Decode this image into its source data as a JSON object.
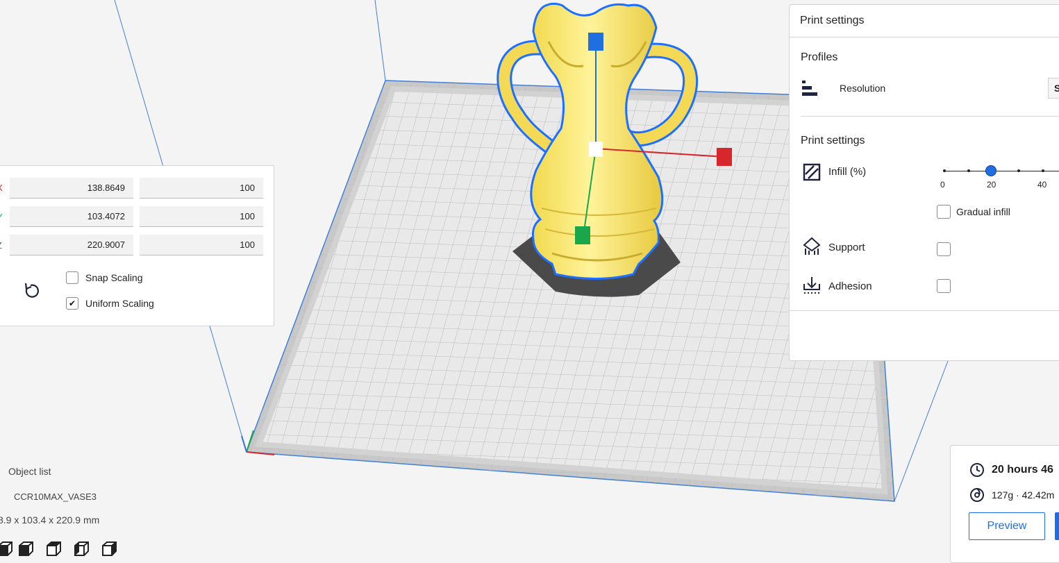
{
  "scale_panel": {
    "axes": [
      {
        "letter": "X",
        "color": "#d7262c",
        "size": "138.8649",
        "percent": "100"
      },
      {
        "letter": "Y",
        "color": "#1aa64a",
        "size": "103.4072",
        "percent": "100"
      },
      {
        "letter": "Z",
        "color": "#2f6fdd",
        "size": "220.9007",
        "percent": "100"
      }
    ],
    "snap_scaling_label": "Snap Scaling",
    "uniform_scaling_label": "Uniform Scaling",
    "snap_scaling_checked": false,
    "uniform_scaling_checked": true,
    "reset_icon": "reset-icon",
    "checkmark": "✔"
  },
  "print_settings": {
    "title": "Print settings",
    "profiles_heading": "Profiles",
    "resolution_label": "Resolution",
    "resolution_value_visible": "S",
    "print_settings_heading": "Print settings",
    "infill_label": "Infill (%)",
    "infill_value": 20,
    "infill_ticks": [
      "0",
      "20",
      "40"
    ],
    "gradual_infill_label": "Gradual infill",
    "support_label": "Support",
    "adhesion_label": "Adhesion",
    "gradual_infill_checked": false,
    "support_checked": false,
    "adhesion_checked": false
  },
  "object_list": {
    "title": "Object list",
    "object_name": "CCR10MAX_VASE3",
    "dimensions": "8.9 x 103.4 x 220.9 mm"
  },
  "job": {
    "time": "20 hours 46",
    "material": "127g · 42.42m",
    "preview_label": "Preview"
  },
  "colors": {
    "accent": "#196ef0",
    "model": "#f6e266",
    "model_outline": "#1d6fff",
    "handle_x": "#d7262c",
    "handle_y": "#1aa64a",
    "handle_z": "#1f6fe0"
  }
}
